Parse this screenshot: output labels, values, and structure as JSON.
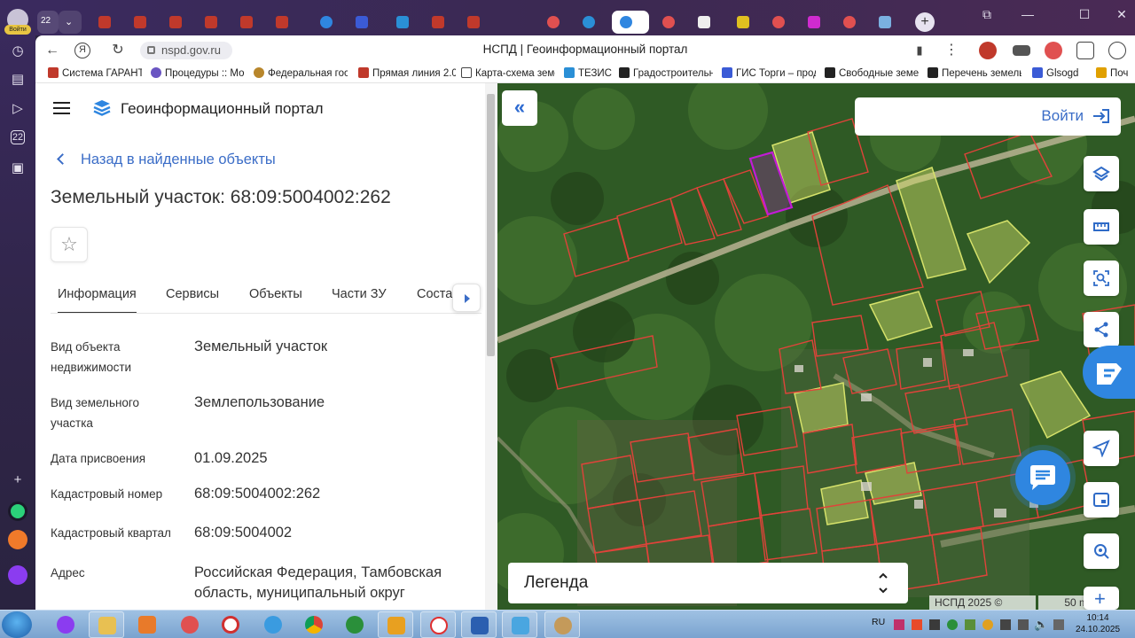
{
  "browser": {
    "tab_count_badge": "22",
    "login_badge": "Войти",
    "url": "nspd.gov.ru",
    "page_title": "НСПД | Геоинформационный портал"
  },
  "bookmarks": [
    {
      "label": "Система ГАРАНТ",
      "color": "#c0392b"
    },
    {
      "label": "Процедуры :: Мо",
      "color": "#6a55c2"
    },
    {
      "label": "Федеральная гос",
      "color": "#b8862b"
    },
    {
      "label": "Прямая линия 2.0",
      "color": "#c0392b"
    },
    {
      "label": "Карта-схема земе",
      "color": "#666666"
    },
    {
      "label": "ТЕЗИС",
      "color": "#2a8fd6"
    },
    {
      "label": "Градостроительн",
      "color": "#222222"
    },
    {
      "label": "ГИС Торги – прод",
      "color": "#3b5bd6"
    },
    {
      "label": "Свободные земел",
      "color": "#222222"
    },
    {
      "label": "Перечень земельн",
      "color": "#222222"
    },
    {
      "label": "Glsogd",
      "color": "#3b5bd6"
    },
    {
      "label": "Поч",
      "color": "#e0a000"
    }
  ],
  "panel": {
    "portal_name": "Геоинформационный портал",
    "back_link": "Назад в найденные объекты",
    "object_title": "Земельный участок: 68:09:5004002:262",
    "favorite_icon": "star-icon",
    "tabs": [
      "Информация",
      "Сервисы",
      "Объекты",
      "Части ЗУ",
      "Соста"
    ],
    "fields": [
      {
        "label": "Вид объекта недвижимости",
        "value": "Земельный участок"
      },
      {
        "label": "Вид земельного участка",
        "value": "Землепользование"
      },
      {
        "label": "Дата присвоения",
        "value": "01.09.2025"
      },
      {
        "label": "Кадастровый номер",
        "value": "68:09:5004002:262"
      },
      {
        "label": "Кадастровый квартал",
        "value": "68:09:5004002"
      },
      {
        "label": "Адрес",
        "value": "Российская Федерация, Тамбовская область, муниципальный округ"
      }
    ]
  },
  "map": {
    "login_label": "Войти",
    "legend_label": "Легенда",
    "attribution": "НСПД 2025 ©",
    "scale": "50 m",
    "colors": {
      "parcel_border": "#e0433a",
      "selected_parcel": "#c21bd6",
      "highlight_fill": "#d6e26a",
      "ui_blue": "#2f86e0"
    }
  },
  "taskbar": {
    "lang": "RU",
    "time": "10:14",
    "date": "24.10.2025"
  }
}
